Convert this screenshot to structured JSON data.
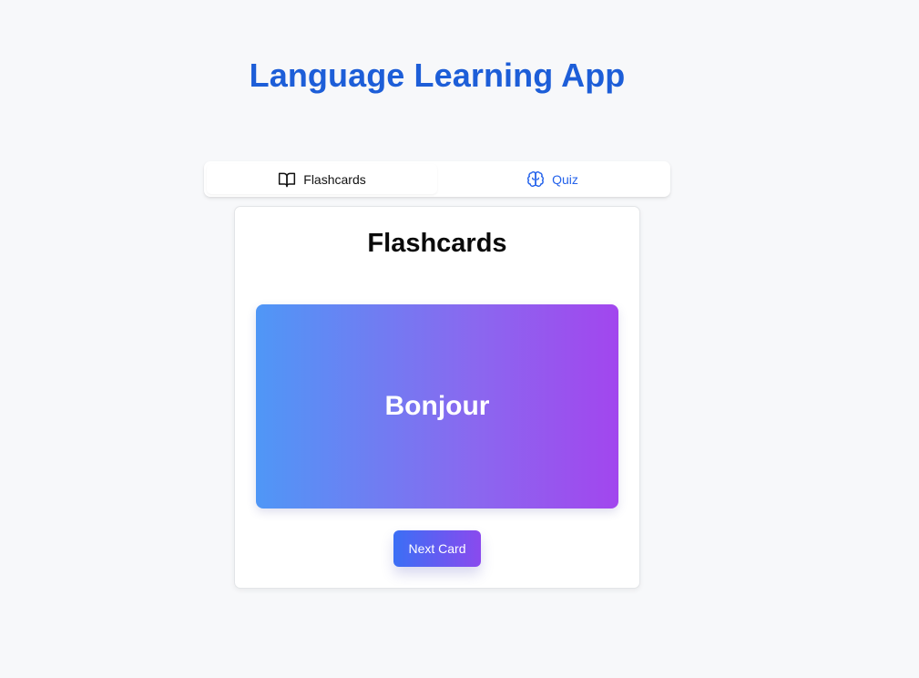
{
  "app": {
    "title": "Language Learning App"
  },
  "tabs": [
    {
      "label": "Flashcards",
      "icon": "book-open-icon",
      "active": true
    },
    {
      "label": "Quiz",
      "icon": "brain-icon",
      "active": false
    }
  ],
  "panel": {
    "title": "Flashcards",
    "card_word": "Bonjour",
    "next_label": "Next Card"
  },
  "colors": {
    "accent": "#1d5ed8",
    "tab_inactive": "#2563eb",
    "card_gradient_start": "#4f97f6",
    "card_gradient_end": "#a246ee",
    "background": "#f7f8fa"
  }
}
